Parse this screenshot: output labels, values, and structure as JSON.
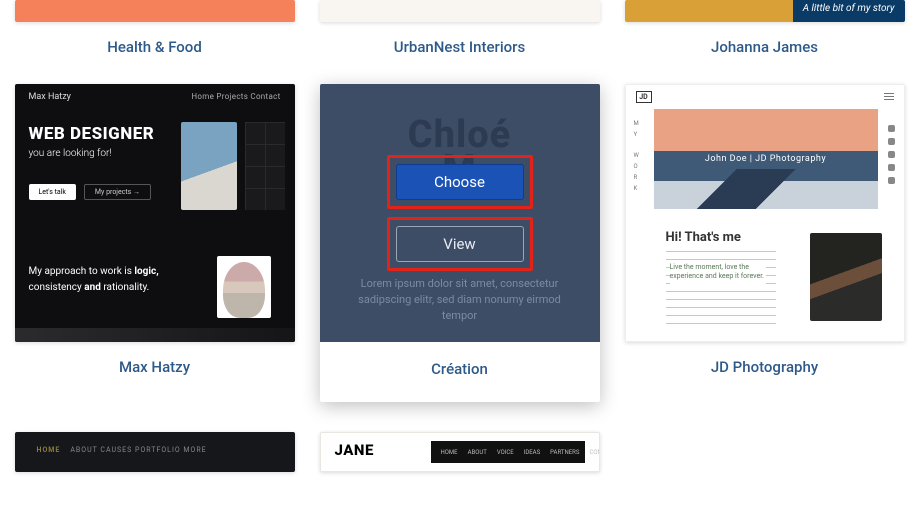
{
  "row1": {
    "a": {
      "label": "Health & Food"
    },
    "b": {
      "label": "UrbanNest Interiors"
    },
    "c": {
      "label": "Johanna James",
      "strap": "A little bit of my story"
    }
  },
  "row2": {
    "max": {
      "label": "Max Hatzy",
      "brand": "Max Hatzy",
      "nav": "Home    Projects    Contact",
      "h1": "WEB DESIGNER",
      "sub": "you are looking for!",
      "btn1": "Let's talk",
      "btn2": "My projects →",
      "mid_a": "My approach to work is ",
      "mid_b": "logic,",
      "mid_c": "consistency ",
      "mid_d": "and",
      "mid_e": " rationality."
    },
    "creation": {
      "label": "Création",
      "ghost_a": "Chloé",
      "ghost_b": "M",
      "choose": "Choose",
      "view": "View",
      "lorem": "Lorem ipsum dolor sit amet, consectetur sadipscing elitr, sed diam nonumy eirmod tempor"
    },
    "jd": {
      "label": "JD Photography",
      "logo": "JD",
      "side": "M\nY\n\nW\nO\nR\nK",
      "hero": "John Doe | JD Photography",
      "h": "Hi! That's me",
      "quote": "Live the moment, love the experience and keep it forever."
    }
  },
  "row3": {
    "a": {
      "nav_active": "HOME",
      "nav_rest": "ABOUT    CAUSES    PORTFOLIO    MORE"
    },
    "b": {
      "logo": "JANE",
      "nav": [
        "HOME",
        "ABOUT",
        "VOICE",
        "IDEAS",
        "PARTNERS",
        "CONTACT"
      ]
    }
  }
}
